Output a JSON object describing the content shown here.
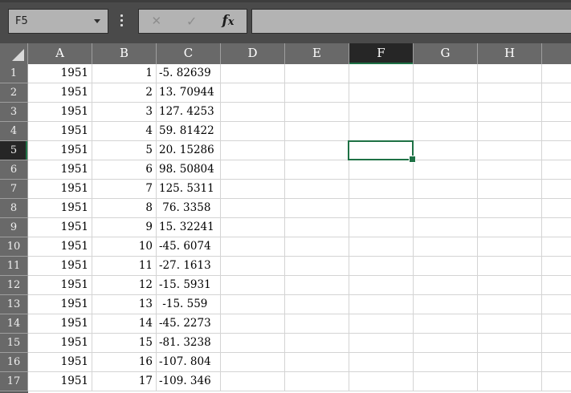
{
  "name_box": {
    "value": "F5"
  },
  "formula_bar": {
    "cancel_icon": "✕",
    "confirm_icon": "✓",
    "fx_label": "fx",
    "input_value": ""
  },
  "colors": {
    "chrome": "#4a4a4a",
    "field": "#b3b3b3",
    "header_gray": "#696969",
    "selected_header": "#262626",
    "accent_green": "#1e7145",
    "gridline": "#d4d4d4"
  },
  "sheet": {
    "columns": [
      "A",
      "B",
      "C",
      "D",
      "E",
      "F",
      "G",
      "H"
    ],
    "selected_column": "F",
    "selected_row": 5,
    "selected_cell": "F5",
    "rows": [
      {
        "n": "1",
        "A": "1951",
        "B": "1",
        "C": "-5. 82639"
      },
      {
        "n": "2",
        "A": "1951",
        "B": "2",
        "C": "13. 70944"
      },
      {
        "n": "3",
        "A": "1951",
        "B": "3",
        "C": "127. 4253"
      },
      {
        "n": "4",
        "A": "1951",
        "B": "4",
        "C": "59. 81422"
      },
      {
        "n": "5",
        "A": "1951",
        "B": "5",
        "C": "20. 15286"
      },
      {
        "n": "6",
        "A": "1951",
        "B": "6",
        "C": "98. 50804"
      },
      {
        "n": "7",
        "A": "1951",
        "B": "7",
        "C": "125. 5311"
      },
      {
        "n": "8",
        "A": "1951",
        "B": "8",
        "C": " 76. 3358"
      },
      {
        "n": "9",
        "A": "1951",
        "B": "9",
        "C": "15. 32241"
      },
      {
        "n": "10",
        "A": "1951",
        "B": "10",
        "C": "-45. 6074"
      },
      {
        "n": "11",
        "A": "1951",
        "B": "11",
        "C": "-27. 1613"
      },
      {
        "n": "12",
        "A": "1951",
        "B": "12",
        "C": "-15. 5931"
      },
      {
        "n": "13",
        "A": "1951",
        "B": "13",
        "C": " -15. 559"
      },
      {
        "n": "14",
        "A": "1951",
        "B": "14",
        "C": "-45. 2273"
      },
      {
        "n": "15",
        "A": "1951",
        "B": "15",
        "C": "-81. 3238"
      },
      {
        "n": "16",
        "A": "1951",
        "B": "16",
        "C": "-107. 804"
      },
      {
        "n": "17",
        "A": "1951",
        "B": "17",
        "C": "-109. 346"
      }
    ]
  }
}
